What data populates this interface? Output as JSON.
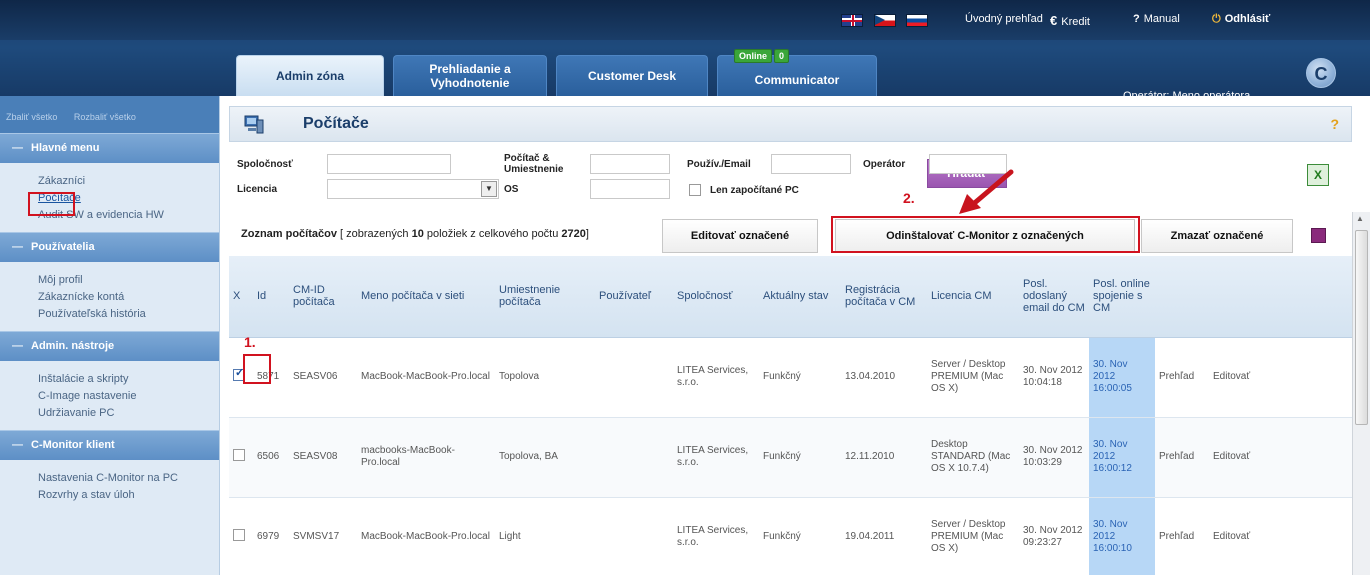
{
  "header": {
    "links": {
      "overview": "Úvodný prehľad",
      "credit": "Kredit",
      "manual": "Manual",
      "logout": "Odhlásiť"
    },
    "tabs": {
      "admin": "Admin zóna",
      "review_line1": "Prehliadanie a",
      "review_line2": "Vyhodnotenie",
      "desk": "Customer Desk",
      "comm": "Communicator"
    },
    "online_badge": {
      "label": "Online",
      "count": "0"
    },
    "operator": "Operátor: Meno operátora",
    "logo_letter": "C"
  },
  "sidebar": {
    "toggles": {
      "collapse": "Zbaliť všetko",
      "expand": "Rozbaliť všetko"
    },
    "sections": [
      {
        "title": "Hlavné menu",
        "items": [
          "Zákazníci",
          "Počítače",
          "Audit SW a evidencia HW"
        ]
      },
      {
        "title": "Používatelia",
        "items": [
          "Môj profil",
          "Zákaznícke kontá",
          "Používateľská história"
        ]
      },
      {
        "title": "Admin. nástroje",
        "items": [
          "Inštalácie a skripty",
          "C-Image nastavenie",
          "Udržiavanie PC"
        ]
      },
      {
        "title": "C-Monitor klient",
        "items": [
          "Nastavenia C-Monitor na PC",
          "Rozvrhy a stav úloh"
        ]
      }
    ],
    "current_item": "Počítače"
  },
  "page": {
    "title": "Počítače",
    "help": "?"
  },
  "filters": {
    "company_label": "Spoločnosť",
    "license_label": "Licencia",
    "pc_location_label_1": "Počítač &",
    "pc_location_label_2": "Umiestnenie",
    "os_label": "OS",
    "user_email_label": "Použív./Email",
    "operator_label": "Operátor",
    "started_only_label": "Len započítané PC",
    "search_button": "Hľadať",
    "excel_icon_glyph": "X"
  },
  "list": {
    "prefix": "Zoznam počítačov",
    "middle": "[ zobrazených",
    "shown": "10",
    "of_total": "položiek z celkového počtu",
    "total": "2720",
    "suffix": "]",
    "edit_button": "Editovať označené",
    "uninstall_button": "Odinštalovať C-Monitor z označených",
    "delete_button": "Zmazať označené"
  },
  "table": {
    "headers": [
      "X",
      "Id",
      "CM-ID počítača",
      "Meno počítača v sieti",
      "Umiestnenie počítača",
      "Používateľ",
      "Spoločnosť",
      "Aktuálny stav",
      "Registrácia počítača v CM",
      "Licencia CM",
      "Posl. odoslaný email do CM",
      "Posl. online spojenie s CM",
      "",
      ""
    ],
    "rows": [
      {
        "checked": true,
        "id": "5871",
        "cmid": "SEASV06",
        "name": "MacBook-MacBook-Pro.local",
        "location": "Topolova",
        "user": "",
        "company": "LITEA Services, s.r.o.",
        "status": "Funkčný",
        "registered": "13.04.2010",
        "license": "Server / Desktop PREMIUM (Mac OS X)",
        "last_email": "30. Nov 2012 10:04:18",
        "last_online": "30. Nov 2012 16:00:05",
        "overview": "Prehľad",
        "edit": "Editovať"
      },
      {
        "checked": false,
        "id": "6506",
        "cmid": "SEASV08",
        "name": "macbooks-MacBook-Pro.local",
        "location": "Topolova, BA",
        "user": "",
        "company": "LITEA Services, s.r.o.",
        "status": "Funkčný",
        "registered": "12.11.2010",
        "license": "Desktop STANDARD (Mac OS X 10.7.4)",
        "last_email": "30. Nov 2012 10:03:29",
        "last_online": "30. Nov 2012 16:00:12",
        "overview": "Prehľad",
        "edit": "Editovať"
      },
      {
        "checked": false,
        "id": "6979",
        "cmid": "SVMSV17",
        "name": "MacBook-MacBook-Pro.local",
        "location": "Light",
        "user": "",
        "company": "LITEA Services, s.r.o.",
        "status": "Funkčný",
        "registered": "19.04.2011",
        "license": "Server / Desktop PREMIUM (Mac OS X)",
        "last_email": "30. Nov 2012 09:23:27",
        "last_online": "30. Nov 2012 16:00:10",
        "overview": "Prehľad",
        "edit": "Editovať"
      }
    ]
  },
  "annotations": {
    "step1": "1.",
    "step2": "2."
  },
  "colors": {
    "header": "#1b3e6a",
    "accent": "#9a55b0",
    "annotation": "#d1121f",
    "online_cell": "#b7d7f6"
  }
}
